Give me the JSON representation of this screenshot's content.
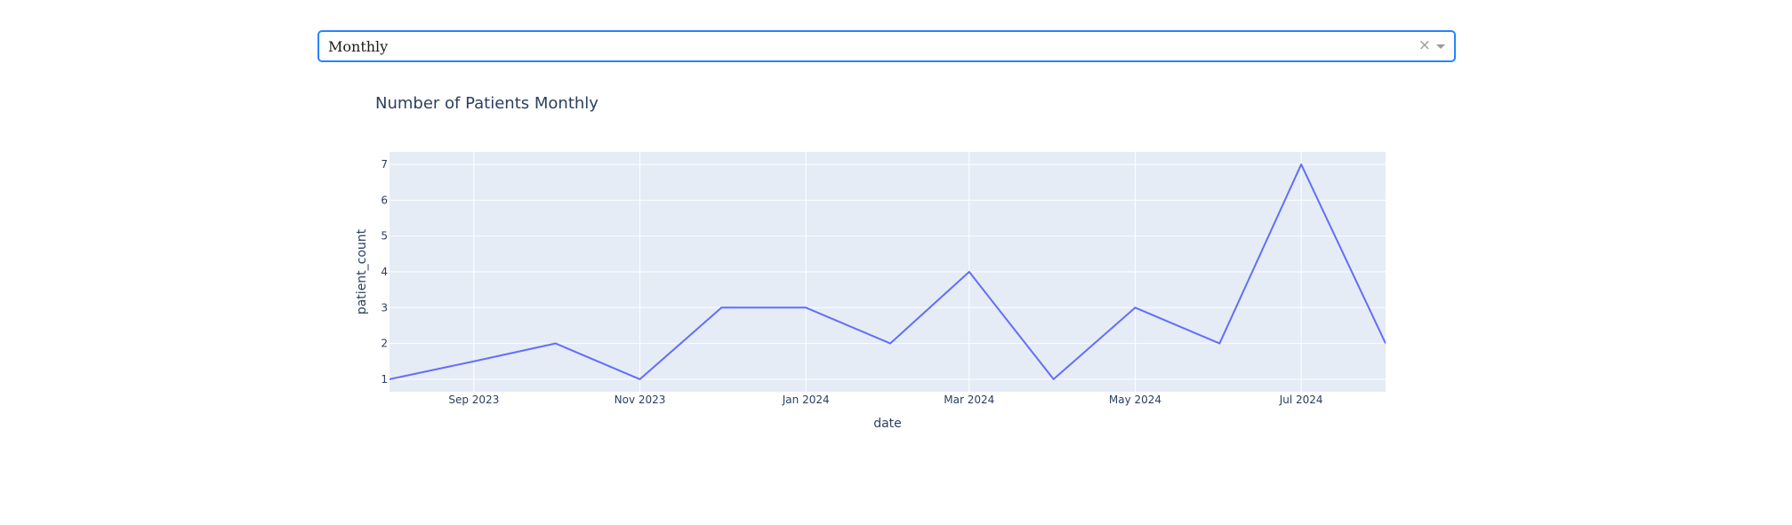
{
  "dropdown": {
    "selected": "Monthly",
    "clear_glyph": "×",
    "caret_icon": "chevron-down-icon"
  },
  "colors": {
    "line": "#636efa",
    "plot_bg": "#e5ecf6",
    "grid": "#ffffff",
    "text": "#2a3f5f",
    "focus_border": "#2684ff"
  },
  "chart_data": {
    "type": "line",
    "title": "Number of Patients Monthly",
    "xlabel": "date",
    "ylabel": "patient_count",
    "grid": true,
    "legend": "none",
    "x": [
      "2023-08-01",
      "2023-09-01",
      "2023-10-01",
      "2023-11-01",
      "2023-12-01",
      "2024-01-01",
      "2024-02-01",
      "2024-03-01",
      "2024-04-01",
      "2024-05-01",
      "2024-06-01",
      "2024-07-01",
      "2024-08-01"
    ],
    "series": [
      {
        "values": [
          1,
          1.5,
          2,
          1,
          3,
          3,
          2,
          4,
          1,
          3,
          2,
          7,
          2
        ]
      }
    ],
    "xlim": [
      "2023-08-01",
      "2024-08-01"
    ],
    "ylim": [
      0.65,
      7.35
    ],
    "x_ticks": [
      {
        "date": "2023-09-01",
        "label": "Sep 2023"
      },
      {
        "date": "2023-11-01",
        "label": "Nov 2023"
      },
      {
        "date": "2024-01-01",
        "label": "Jan 2024"
      },
      {
        "date": "2024-03-01",
        "label": "Mar 2024"
      },
      {
        "date": "2024-05-01",
        "label": "May 2024"
      },
      {
        "date": "2024-07-01",
        "label": "Jul 2024"
      }
    ],
    "y_ticks": [
      1,
      2,
      3,
      4,
      5,
      6,
      7
    ]
  }
}
